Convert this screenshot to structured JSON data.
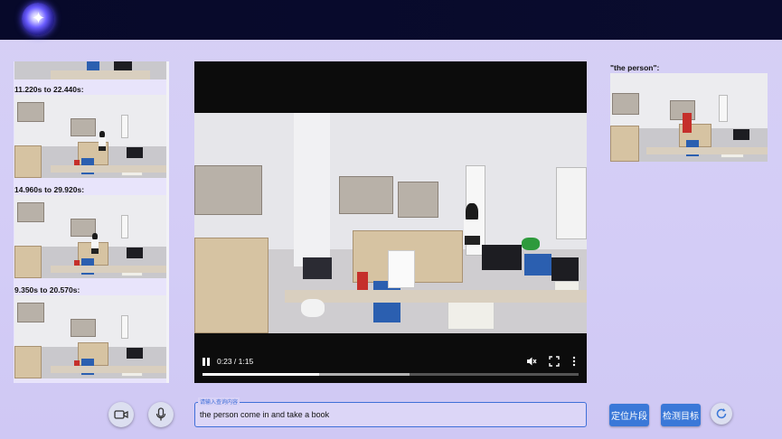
{
  "header": {
    "logo_icon": "app-logo-icon"
  },
  "segments": [
    {
      "label": ""
    },
    {
      "label": "11.220s to 22.440s:"
    },
    {
      "label": "14.960s to 29.920s:"
    },
    {
      "label": "9.350s to 20.570s:"
    }
  ],
  "video": {
    "time": "0:23 / 1:15",
    "played_fraction": 0.31,
    "buffered_fraction": 0.55,
    "icons": [
      "pause-icon",
      "mute-icon",
      "fullscreen-icon",
      "more-vert-icon"
    ]
  },
  "result": {
    "label": "\"the person\":"
  },
  "query": {
    "legend": "请输入查询内容",
    "value": "the person come in and take a book"
  },
  "buttons": {
    "locate": "定位片段",
    "detect": "检测目标"
  },
  "icons": {
    "camera": "video-camera-icon",
    "mic": "microphone-icon",
    "refresh": "refresh-icon"
  },
  "colors": {
    "accent": "#3a78d8",
    "header": "#07092a",
    "background": "#d6d0f5"
  }
}
